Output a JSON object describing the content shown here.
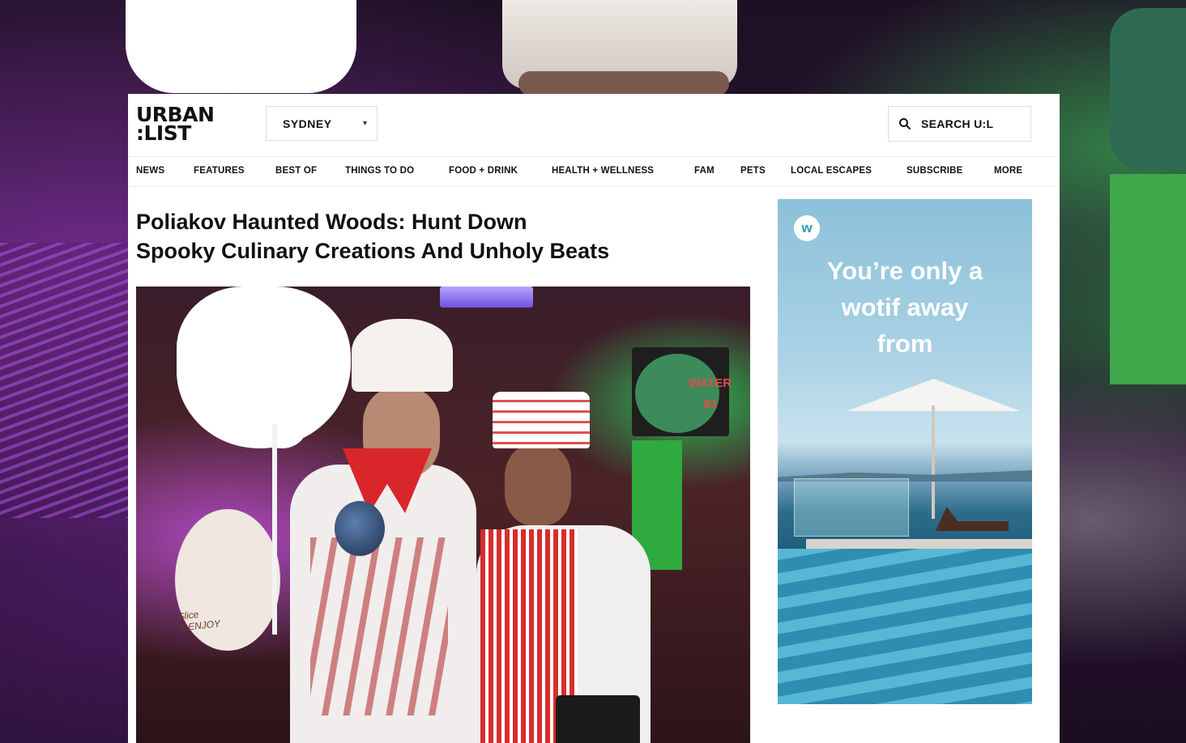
{
  "site": {
    "logo_line1": "URBAN",
    "logo_line2": ":LIST",
    "city": "SYDNEY",
    "search_label": "SEARCH U:L"
  },
  "nav": {
    "items": [
      "NEWS",
      "FEATURES",
      "BEST OF",
      "THINGS TO DO",
      "FOOD + DRINK",
      "HEALTH + WELLNESS",
      "FAM",
      "PETS",
      "LOCAL ESCAPES",
      "SUBSCRIBE",
      "MORE"
    ]
  },
  "article": {
    "title_line1": "Poliakov Haunted Woods: Hunt Down",
    "title_line2": "Spooky Culinary Creations And Unholy Beats",
    "hero_sign_text_1": "WATER",
    "hero_sign_text_2": "$3",
    "hero_board_text_1": "Slice",
    "hero_board_text_2": "& ENJOY"
  },
  "ad": {
    "logo_letter": "w",
    "line1": "You’re only a",
    "line2": "wotif away",
    "line3": "from"
  },
  "colors": {
    "text": "#111111",
    "border": "#dddddd",
    "accent_green": "#2faa3f",
    "accent_purple": "#b04ad8"
  },
  "icons": {
    "search": "search-icon",
    "caret": "caret-down-icon"
  }
}
